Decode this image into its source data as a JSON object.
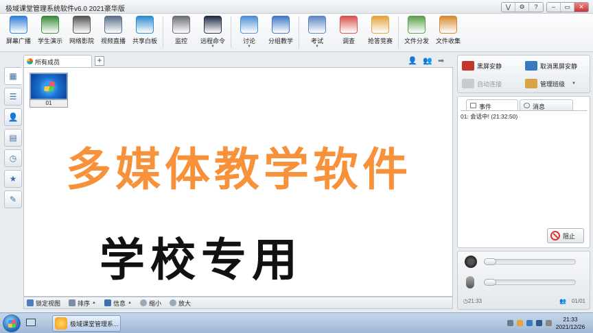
{
  "window": {
    "title": "极域课堂管理系统软件v6.0 2021豪华版",
    "controls": [
      "⋁",
      "⚙",
      "?",
      "–",
      "▭",
      "✕"
    ]
  },
  "toolbar": {
    "groups": [
      [
        {
          "label": "屏幕广播",
          "icon": "screen-broadcast-icon",
          "color": "#2f7fd8"
        },
        {
          "label": "学生演示",
          "icon": "student-demo-icon",
          "color": "#3b8a3b"
        },
        {
          "label": "网络影院",
          "icon": "film-reel-icon",
          "color": "#555555"
        },
        {
          "label": "视频直播",
          "icon": "webcam-icon",
          "color": "#5a6f8a"
        },
        {
          "label": "共享白板",
          "icon": "whiteboard-icon",
          "color": "#2e8bd0"
        }
      ],
      [
        {
          "label": "监控",
          "icon": "monitor-person-icon",
          "color": "#6b6f76"
        },
        {
          "label": "远程命令",
          "icon": "command-prompt-icon",
          "color": "#1f2d45",
          "dropdown": true
        }
      ],
      [
        {
          "label": "讨论",
          "icon": "chat-bubble-icon",
          "color": "#4c8fd6",
          "dropdown": true
        },
        {
          "label": "分组教学",
          "icon": "group-teaching-icon",
          "color": "#3f79c4"
        }
      ],
      [
        {
          "label": "考试",
          "icon": "exam-clock-icon",
          "color": "#5b86c4",
          "dropdown": true
        },
        {
          "label": "调查",
          "icon": "survey-bars-icon",
          "color": "#d9534f"
        },
        {
          "label": "抢答竞赛",
          "icon": "quiz-star-icon",
          "color": "#e6a23c"
        }
      ],
      [
        {
          "label": "文件分发",
          "icon": "file-distribute-icon",
          "color": "#5aa04a"
        },
        {
          "label": "文件收集",
          "icon": "file-collect-icon",
          "color": "#d68a2e"
        }
      ]
    ]
  },
  "left_tabs": [
    {
      "icon": "thumbnail-view-icon",
      "active": true
    },
    {
      "icon": "list-view-icon"
    },
    {
      "icon": "user-remove-icon"
    },
    {
      "icon": "document-icon"
    },
    {
      "icon": "schedule-icon"
    },
    {
      "icon": "user-star-icon"
    },
    {
      "icon": "edit-board-icon"
    }
  ],
  "main": {
    "tab_label": "所有成员",
    "add_tab": "+",
    "students": [
      {
        "label": "01"
      }
    ],
    "overlay_line1": "多媒体教学软件",
    "overlay_line2": "学校专用"
  },
  "statusbar": {
    "lock_view": "锁定视图",
    "sort": "排序",
    "info": "信息",
    "zoom_out": "缩小",
    "zoom_in": "放大"
  },
  "right": {
    "black_screen": "黑屏安静",
    "cancel_black_screen": "取消黑屏安静",
    "auto_connect": "自动连接",
    "manage_class": "管理班级",
    "tab_events": "事件",
    "tab_messages": "消息",
    "event_line": "01: 会话中! (21:32:50)",
    "stop_button": "阻止",
    "audio": {
      "speaker_level": 0.0,
      "mic_level": 0.0
    },
    "time": "21:33",
    "online_count": "01/01"
  },
  "taskbar": {
    "task_label": "极域课堂管理系...",
    "clock_time": "21:33",
    "clock_date": "2021/12/26"
  }
}
